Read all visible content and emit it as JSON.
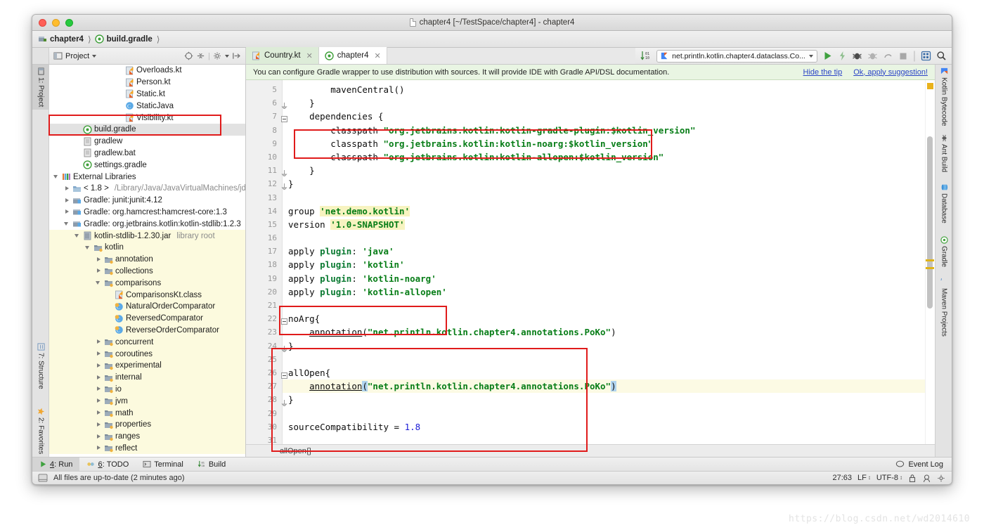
{
  "window": {
    "title": "chapter4 [~/TestSpace/chapter4] - chapter4",
    "traffic": [
      "close",
      "minimize",
      "zoom"
    ]
  },
  "navbar": {
    "crumbs": [
      {
        "label": "chapter4",
        "icon": "module-icon"
      },
      {
        "label": "build.gradle",
        "icon": "gradle-icon"
      }
    ]
  },
  "project_toolwindow": {
    "title": "Project",
    "dropdown": "▾",
    "icons": [
      "target-icon",
      "collapse-icon",
      "settings-icon",
      "hide-icon"
    ]
  },
  "editor_tabs": [
    {
      "label": "Country.kt",
      "icon": "kotlin-file-icon",
      "active": false
    },
    {
      "label": "chapter4",
      "icon": "gradle-icon",
      "active": true
    }
  ],
  "run_toolbar": {
    "sort_icon": "sort-icon",
    "config_name": "net.println.kotlin.chapter4.dataclass.Co...",
    "buttons": [
      "run-icon",
      "apply-icon",
      "debug-icon",
      "coverage-icon",
      "profile-icon",
      "stop-icon",
      "layout-icon",
      "search-icon"
    ]
  },
  "tip_bar": {
    "message": "You can configure Gradle wrapper to use distribution with sources. It will provide IDE with Gradle API/DSL documentation.",
    "hide_link": "Hide the tip",
    "apply_link": "Ok, apply suggestion!"
  },
  "left_toolwindows": [
    {
      "label": "1: Project",
      "selected": true
    },
    {
      "label": "7: Structure",
      "selected": false
    },
    {
      "label": "2: Favorites",
      "selected": false
    }
  ],
  "right_toolwindows": [
    {
      "label": "Kotlin Bytecode"
    },
    {
      "label": "Ant Build"
    },
    {
      "label": "Database"
    },
    {
      "label": "Gradle"
    },
    {
      "label": "Maven Projects"
    }
  ],
  "project_tree": [
    {
      "label": "Overloads.kt",
      "indent": 6,
      "icon": "kotlin-file-icon",
      "arrow": "none",
      "state": "normal"
    },
    {
      "label": "Person.kt",
      "indent": 6,
      "icon": "kotlin-file-icon",
      "arrow": "none",
      "state": "normal"
    },
    {
      "label": "Static.kt",
      "indent": 6,
      "icon": "kotlin-file-icon",
      "arrow": "none",
      "state": "normal"
    },
    {
      "label": "StaticJava",
      "indent": 6,
      "icon": "java-class-icon",
      "arrow": "none",
      "state": "normal"
    },
    {
      "label": "Visibility.kt",
      "indent": 6,
      "icon": "kotlin-file-icon",
      "arrow": "none",
      "state": "normal"
    },
    {
      "label": "build.gradle",
      "indent": 2,
      "icon": "gradle-icon",
      "arrow": "none",
      "state": "selected"
    },
    {
      "label": "gradlew",
      "indent": 2,
      "icon": "file-icon",
      "arrow": "none",
      "state": "normal"
    },
    {
      "label": "gradlew.bat",
      "indent": 2,
      "icon": "file-icon",
      "arrow": "none",
      "state": "normal"
    },
    {
      "label": "settings.gradle",
      "indent": 2,
      "icon": "gradle-icon",
      "arrow": "none",
      "state": "normal"
    },
    {
      "label": "External Libraries",
      "indent": 0,
      "icon": "libraries-icon",
      "arrow": "open",
      "state": "normal"
    },
    {
      "label": "< 1.8 >",
      "suffix": "/Library/Java/JavaVirtualMachines/jdk",
      "indent": 1,
      "icon": "jdk-icon",
      "arrow": "closed",
      "state": "normal"
    },
    {
      "label": "Gradle: junit:junit:4.12",
      "indent": 1,
      "icon": "lib-icon",
      "arrow": "closed",
      "state": "normal"
    },
    {
      "label": "Gradle: org.hamcrest:hamcrest-core:1.3",
      "indent": 1,
      "icon": "lib-icon",
      "arrow": "closed",
      "state": "normal"
    },
    {
      "label": "Gradle: org.jetbrains.kotlin:kotlin-stdlib:1.2.3",
      "indent": 1,
      "icon": "lib-icon",
      "arrow": "open",
      "state": "normal"
    },
    {
      "label": "kotlin-stdlib-1.2.30.jar",
      "suffix": "library root",
      "indent": 2,
      "icon": "jar-icon",
      "arrow": "open",
      "state": "highlight"
    },
    {
      "label": "kotlin",
      "indent": 3,
      "icon": "package-icon",
      "arrow": "open",
      "state": "highlight"
    },
    {
      "label": "annotation",
      "indent": 4,
      "icon": "package-icon",
      "arrow": "closed",
      "state": "highlight"
    },
    {
      "label": "collections",
      "indent": 4,
      "icon": "package-icon",
      "arrow": "closed",
      "state": "highlight"
    },
    {
      "label": "comparisons",
      "indent": 4,
      "icon": "package-icon",
      "arrow": "open",
      "state": "highlight"
    },
    {
      "label": "ComparisonsKt.class",
      "indent": 5,
      "icon": "kotlin-class-icon",
      "arrow": "none",
      "state": "highlight"
    },
    {
      "label": "NaturalOrderComparator",
      "indent": 5,
      "icon": "class-icon",
      "arrow": "none",
      "state": "highlight"
    },
    {
      "label": "ReversedComparator",
      "indent": 5,
      "icon": "class-icon",
      "arrow": "none",
      "state": "highlight"
    },
    {
      "label": "ReverseOrderComparator",
      "indent": 5,
      "icon": "class-icon",
      "arrow": "none",
      "state": "highlight"
    },
    {
      "label": "concurrent",
      "indent": 4,
      "icon": "package-icon",
      "arrow": "closed",
      "state": "highlight"
    },
    {
      "label": "coroutines",
      "indent": 4,
      "icon": "package-icon",
      "arrow": "closed",
      "state": "highlight"
    },
    {
      "label": "experimental",
      "indent": 4,
      "icon": "package-icon",
      "arrow": "closed",
      "state": "highlight"
    },
    {
      "label": "internal",
      "indent": 4,
      "icon": "package-icon",
      "arrow": "closed",
      "state": "highlight"
    },
    {
      "label": "io",
      "indent": 4,
      "icon": "package-icon",
      "arrow": "closed",
      "state": "highlight"
    },
    {
      "label": "jvm",
      "indent": 4,
      "icon": "package-icon",
      "arrow": "closed",
      "state": "highlight"
    },
    {
      "label": "math",
      "indent": 4,
      "icon": "package-icon",
      "arrow": "closed",
      "state": "highlight"
    },
    {
      "label": "properties",
      "indent": 4,
      "icon": "package-icon",
      "arrow": "closed",
      "state": "highlight"
    },
    {
      "label": "ranges",
      "indent": 4,
      "icon": "package-icon",
      "arrow": "closed",
      "state": "highlight"
    },
    {
      "label": "reflect",
      "indent": 4,
      "icon": "package-icon",
      "arrow": "closed",
      "state": "highlight"
    }
  ],
  "editor": {
    "first_line_number": 5,
    "lines": [
      {
        "n": 5,
        "text": "        mavenCentral()"
      },
      {
        "n": 6,
        "text": "    }"
      },
      {
        "n": 7,
        "text": "    dependencies {"
      },
      {
        "n": 8,
        "text": "        classpath \"org.jetbrains.kotlin:kotlin-gradle-plugin:$kotlin_version\""
      },
      {
        "n": 9,
        "text": "        classpath \"org.jetbrains.kotlin:kotlin-noarg:$kotlin_version\""
      },
      {
        "n": 10,
        "text": "        classpath \"org.jetbrains.kotlin:kotlin-allopen:$kotlin_version\""
      },
      {
        "n": 11,
        "text": "    }"
      },
      {
        "n": 12,
        "text": "}"
      },
      {
        "n": 13,
        "text": ""
      },
      {
        "n": 14,
        "text": "group 'net.demo.kotlin'"
      },
      {
        "n": 15,
        "text": "version '1.0-SNAPSHOT'"
      },
      {
        "n": 16,
        "text": ""
      },
      {
        "n": 17,
        "text": "apply plugin: 'java'"
      },
      {
        "n": 18,
        "text": "apply plugin: 'kotlin'"
      },
      {
        "n": 19,
        "text": "apply plugin: 'kotlin-noarg'"
      },
      {
        "n": 20,
        "text": "apply plugin: 'kotlin-allopen'"
      },
      {
        "n": 21,
        "text": ""
      },
      {
        "n": 22,
        "text": "noArg{"
      },
      {
        "n": 23,
        "text": "    annotation(\"net.println.kotlin.chapter4.annotations.PoKo\")"
      },
      {
        "n": 24,
        "text": "}"
      },
      {
        "n": 25,
        "text": ""
      },
      {
        "n": 26,
        "text": "allOpen{"
      },
      {
        "n": 27,
        "text": "    annotation(\"net.println.kotlin.chapter4.annotations.PoKo\")"
      },
      {
        "n": 28,
        "text": "}"
      },
      {
        "n": 29,
        "text": ""
      },
      {
        "n": 30,
        "text": "sourceCompatibility = 1.8"
      },
      {
        "n": 31,
        "text": ""
      }
    ],
    "caret_line": 27,
    "breadcrumb": "allOpen{}"
  },
  "bottom_tabs": [
    {
      "num": "4",
      "label": "Run",
      "icon": "run-icon",
      "selected": true
    },
    {
      "num": "6",
      "label": "TODO",
      "icon": "todo-icon",
      "selected": false
    },
    {
      "num": "",
      "label": "Terminal",
      "icon": "terminal-icon",
      "selected": false
    },
    {
      "num": "",
      "label": "Build",
      "icon": "build-icon",
      "selected": false
    }
  ],
  "event_log": {
    "label": "Event Log",
    "icon": "balloon-icon"
  },
  "status_bar": {
    "message": "All files are up-to-date (2 minutes ago)",
    "caret_position": "27:63",
    "line_separator": "LF",
    "encoding": "UTF-8",
    "icons": [
      "lock-icon",
      "hector-icon",
      "settings-icon"
    ]
  },
  "watermark": "https://blog.csdn.net/wd2014610",
  "colors": {
    "annotation_red": "#e01b1b",
    "tip_background": "#e9f5e3",
    "highlight_yellow": "#fcfade",
    "keyword_green": "#0b7a32",
    "string_green": "#077d17",
    "link_blue": "#2b44c7"
  }
}
